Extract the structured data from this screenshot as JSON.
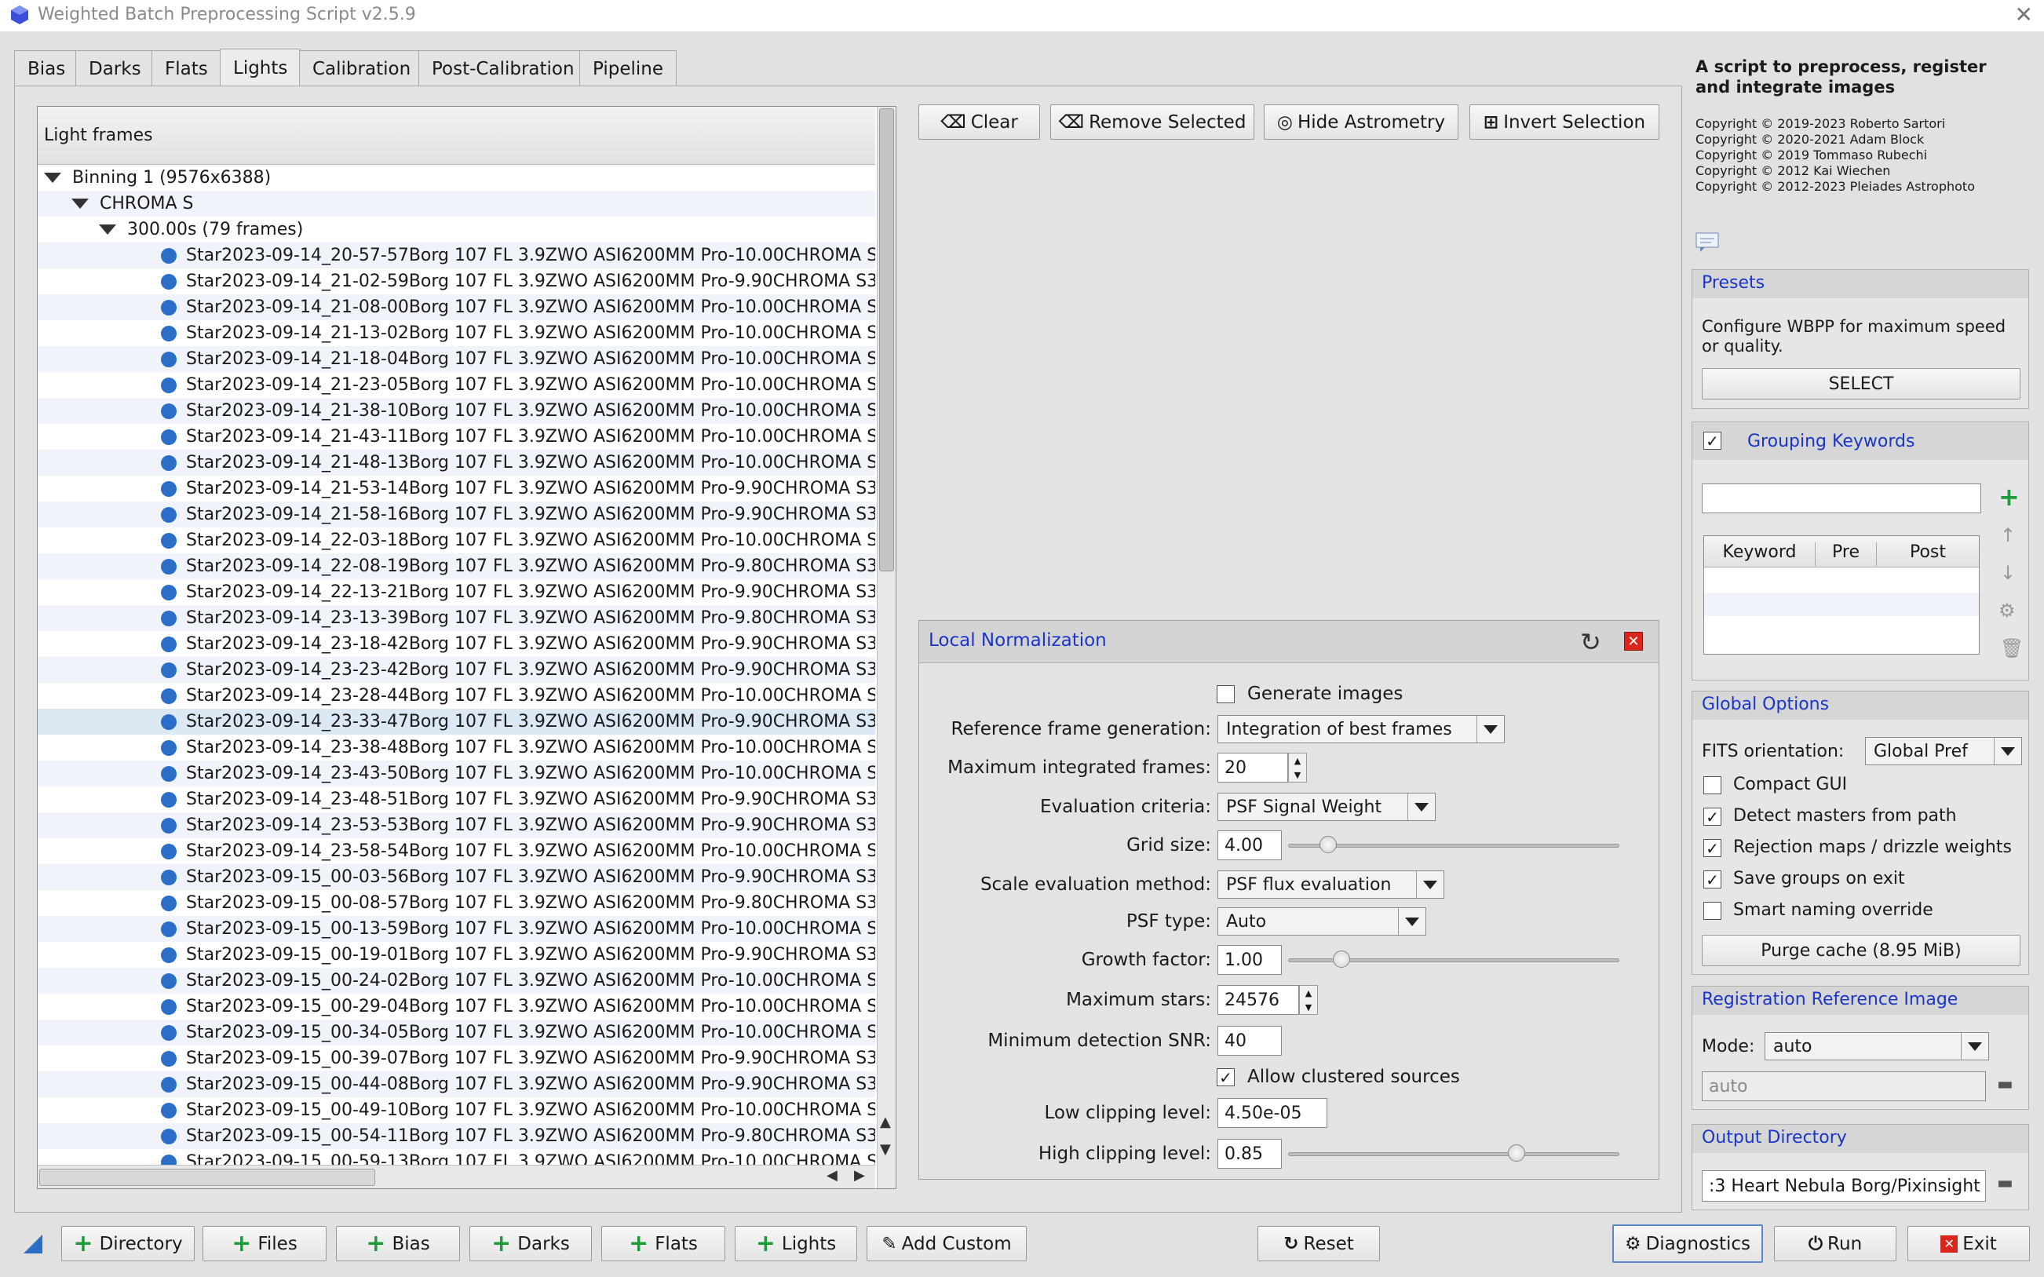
{
  "window": {
    "title": "Weighted Batch Preprocessing Script v2.5.9",
    "close_glyph": "✕"
  },
  "tabs": [
    {
      "label": "Bias"
    },
    {
      "label": "Darks"
    },
    {
      "label": "Flats"
    },
    {
      "label": "Lights",
      "active": true
    },
    {
      "label": "Calibration"
    },
    {
      "label": "Post-Calibration"
    },
    {
      "label": "Pipeline"
    }
  ],
  "tree": {
    "header": "Light frames",
    "group_binning": "Binning 1 (9576x6388)",
    "group_filter": "CHROMA S",
    "group_exposure": "300.00s (79 frames)",
    "frames": [
      "Star2023-09-14_20-57-57Borg 107 FL 3.9ZWO ASI6200MM Pro-10.00CHROMA S",
      "Star2023-09-14_21-02-59Borg 107 FL 3.9ZWO ASI6200MM Pro-9.90CHROMA S3",
      "Star2023-09-14_21-08-00Borg 107 FL 3.9ZWO ASI6200MM Pro-10.00CHROMA S",
      "Star2023-09-14_21-13-02Borg 107 FL 3.9ZWO ASI6200MM Pro-10.00CHROMA S",
      "Star2023-09-14_21-18-04Borg 107 FL 3.9ZWO ASI6200MM Pro-10.00CHROMA S",
      "Star2023-09-14_21-23-05Borg 107 FL 3.9ZWO ASI6200MM Pro-10.00CHROMA S",
      "Star2023-09-14_21-38-10Borg 107 FL 3.9ZWO ASI6200MM Pro-10.00CHROMA S",
      "Star2023-09-14_21-43-11Borg 107 FL 3.9ZWO ASI6200MM Pro-10.00CHROMA S",
      "Star2023-09-14_21-48-13Borg 107 FL 3.9ZWO ASI6200MM Pro-10.00CHROMA S",
      "Star2023-09-14_21-53-14Borg 107 FL 3.9ZWO ASI6200MM Pro-9.90CHROMA S3",
      "Star2023-09-14_21-58-16Borg 107 FL 3.9ZWO ASI6200MM Pro-9.90CHROMA S3",
      "Star2023-09-14_22-03-18Borg 107 FL 3.9ZWO ASI6200MM Pro-10.00CHROMA S",
      "Star2023-09-14_22-08-19Borg 107 FL 3.9ZWO ASI6200MM Pro-9.80CHROMA S3",
      "Star2023-09-14_22-13-21Borg 107 FL 3.9ZWO ASI6200MM Pro-9.90CHROMA S3",
      "Star2023-09-14_23-13-39Borg 107 FL 3.9ZWO ASI6200MM Pro-9.80CHROMA S3",
      "Star2023-09-14_23-18-42Borg 107 FL 3.9ZWO ASI6200MM Pro-9.90CHROMA S3",
      "Star2023-09-14_23-23-42Borg 107 FL 3.9ZWO ASI6200MM Pro-9.90CHROMA S3",
      "Star2023-09-14_23-28-44Borg 107 FL 3.9ZWO ASI6200MM Pro-10.00CHROMA S",
      "Star2023-09-14_23-33-47Borg 107 FL 3.9ZWO ASI6200MM Pro-9.90CHROMA S3",
      "Star2023-09-14_23-38-48Borg 107 FL 3.9ZWO ASI6200MM Pro-10.00CHROMA S",
      "Star2023-09-14_23-43-50Borg 107 FL 3.9ZWO ASI6200MM Pro-10.00CHROMA S",
      "Star2023-09-14_23-48-51Borg 107 FL 3.9ZWO ASI6200MM Pro-9.90CHROMA S3",
      "Star2023-09-14_23-53-53Borg 107 FL 3.9ZWO ASI6200MM Pro-9.90CHROMA S3",
      "Star2023-09-14_23-58-54Borg 107 FL 3.9ZWO ASI6200MM Pro-10.00CHROMA S",
      "Star2023-09-15_00-03-56Borg 107 FL 3.9ZWO ASI6200MM Pro-9.90CHROMA S3",
      "Star2023-09-15_00-08-57Borg 107 FL 3.9ZWO ASI6200MM Pro-9.80CHROMA S3",
      "Star2023-09-15_00-13-59Borg 107 FL 3.9ZWO ASI6200MM Pro-10.00CHROMA S",
      "Star2023-09-15_00-19-01Borg 107 FL 3.9ZWO ASI6200MM Pro-9.90CHROMA S3",
      "Star2023-09-15_00-24-02Borg 107 FL 3.9ZWO ASI6200MM Pro-10.00CHROMA S",
      "Star2023-09-15_00-29-04Borg 107 FL 3.9ZWO ASI6200MM Pro-10.00CHROMA S",
      "Star2023-09-15_00-34-05Borg 107 FL 3.9ZWO ASI6200MM Pro-10.00CHROMA S",
      "Star2023-09-15_00-39-07Borg 107 FL 3.9ZWO ASI6200MM Pro-9.90CHROMA S3",
      "Star2023-09-15_00-44-08Borg 107 FL 3.9ZWO ASI6200MM Pro-9.90CHROMA S3",
      "Star2023-09-15_00-49-10Borg 107 FL 3.9ZWO ASI6200MM Pro-10.00CHROMA S",
      "Star2023-09-15_00-54-11Borg 107 FL 3.9ZWO ASI6200MM Pro-9.80CHROMA S3",
      "Star2023-09-15_00-59-13Borg 107 FL 3.9ZWO ASI6200MM Pro-10.00CHROMA S"
    ],
    "selected_frame_index": 18
  },
  "toolbar": {
    "clear": "Clear",
    "remove_selected": "Remove Selected",
    "hide_astrometry": "Hide Astrometry",
    "invert_selection": "Invert Selection"
  },
  "local_normalization": {
    "title": "Local Normalization",
    "generate_images_label": "Generate images",
    "generate_images_checked": false,
    "ref_frame_label": "Reference frame generation:",
    "ref_frame_value": "Integration of best frames",
    "max_frames_label": "Maximum integrated frames:",
    "max_frames_value": "20",
    "eval_criteria_label": "Evaluation criteria:",
    "eval_criteria_value": "PSF Signal Weight",
    "grid_size_label": "Grid size:",
    "grid_size_value": "4.00",
    "grid_size_slider": 0.12,
    "scale_eval_label": "Scale evaluation method:",
    "scale_eval_value": "PSF flux evaluation",
    "psf_type_label": "PSF type:",
    "psf_type_value": "Auto",
    "growth_label": "Growth factor:",
    "growth_value": "1.00",
    "growth_slider": 0.16,
    "max_stars_label": "Maximum stars:",
    "max_stars_value": "24576",
    "min_snr_label": "Minimum detection SNR:",
    "min_snr_value": "40",
    "allow_clustered_label": "Allow clustered sources",
    "allow_clustered_checked": true,
    "low_clip_label": "Low clipping level:",
    "low_clip_value": "4.50e-05",
    "high_clip_label": "High clipping level:",
    "high_clip_value": "0.85",
    "high_clip_slider": 0.69
  },
  "side": {
    "description": "A script to preprocess, register and integrate images",
    "copyrights": [
      "Copyright © 2019-2023 Roberto Sartori",
      "Copyright © 2020-2021 Adam Block",
      "Copyright © 2019 Tommaso Rubechi",
      "Copyright © 2012 Kai Wiechen",
      "Copyright © 2012-2023 Pleiades Astrophoto"
    ],
    "presets_title": "Presets",
    "presets_text": "Configure WBPP for maximum speed or quality.",
    "presets_button": "SELECT",
    "grouping_title": "Grouping Keywords",
    "grouping_checked": true,
    "grouping_columns": [
      "Keyword",
      "Pre",
      "Post"
    ],
    "global_title": "Global Options",
    "fits_label": "FITS orientation:",
    "fits_value": "Global Pref",
    "options": [
      {
        "label": "Compact GUI",
        "checked": false
      },
      {
        "label": "Detect masters from path",
        "checked": true
      },
      {
        "label": "Rejection maps / drizzle weights",
        "checked": true
      },
      {
        "label": "Save groups on exit",
        "checked": true
      },
      {
        "label": "Smart naming override",
        "checked": false
      }
    ],
    "purge_button": "Purge cache (8.95 MiB)",
    "reg_title": "Registration Reference Image",
    "mode_label": "Mode:",
    "mode_value": "auto",
    "reg_field_value": "auto",
    "output_title": "Output Directory",
    "output_value": ":3 Heart Nebula Borg/Pixinsight"
  },
  "bottom": {
    "directory": "Directory",
    "files": "Files",
    "bias": "Bias",
    "darks": "Darks",
    "flats": "Flats",
    "lights": "Lights",
    "add_custom": "Add Custom",
    "reset": "Reset",
    "diagnostics": "Diagnostics",
    "run": "Run",
    "exit": "Exit"
  },
  "colors": {
    "accent": "#1a35c9",
    "frame_dot": "#2a6ec7",
    "add_green": "#1f9a3a",
    "exit_red": "#d9261c"
  }
}
